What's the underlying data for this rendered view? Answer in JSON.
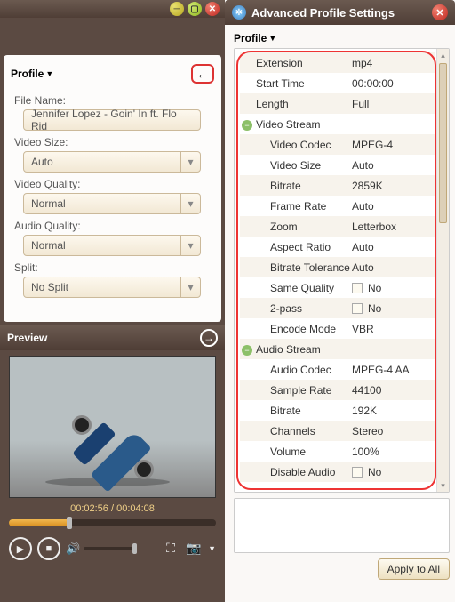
{
  "left": {
    "profile_header": "Profile",
    "back_icon": "←",
    "file_name_label": "File Name:",
    "file_name_value": "Jennifer Lopez - Goin' In ft. Flo Rid",
    "video_size_label": "Video Size:",
    "video_size_value": "Auto",
    "video_quality_label": "Video Quality:",
    "video_quality_value": "Normal",
    "audio_quality_label": "Audio Quality:",
    "audio_quality_value": "Normal",
    "split_label": "Split:",
    "split_value": "No Split",
    "preview_header": "Preview",
    "timecode": "00:02:56 / 00:04:08"
  },
  "right": {
    "title": "Advanced Profile Settings",
    "profile_header": "Profile",
    "rows": {
      "extension_l": "Extension",
      "extension_v": "mp4",
      "start_l": "Start Time",
      "start_v": "00:00:00",
      "length_l": "Length",
      "length_v": "Full",
      "vstream": "Video Stream",
      "vcodec_l": "Video Codec",
      "vcodec_v": "MPEG-4",
      "vsize_l": "Video Size",
      "vsize_v": "Auto",
      "vbitrate_l": "Bitrate",
      "vbitrate_v": "2859K",
      "vfr_l": "Frame Rate",
      "vfr_v": "Auto",
      "zoom_l": "Zoom",
      "zoom_v": "Letterbox",
      "ar_l": "Aspect Ratio",
      "ar_v": "Auto",
      "btol_l": "Bitrate Tolerance",
      "btol_v": "Auto",
      "sq_l": "Same Quality",
      "sq_v": "No",
      "tp_l": "2-pass",
      "tp_v": "No",
      "em_l": "Encode Mode",
      "em_v": "VBR",
      "astream": "Audio Stream",
      "acodec_l": "Audio Codec",
      "acodec_v": "MPEG-4 AA",
      "sr_l": "Sample Rate",
      "sr_v": "44100",
      "abitrate_l": "Bitrate",
      "abitrate_v": "192K",
      "ch_l": "Channels",
      "ch_v": "Stereo",
      "vol_l": "Volume",
      "vol_v": "100%",
      "da_l": "Disable Audio",
      "da_v": "No"
    },
    "apply_label": "Apply to All"
  }
}
